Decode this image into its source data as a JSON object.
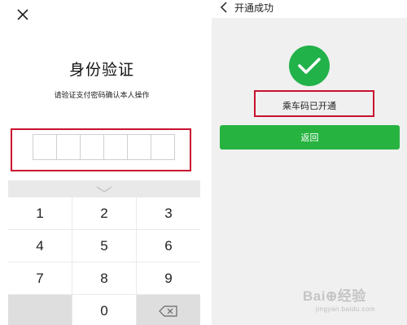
{
  "left": {
    "title": "身份验证",
    "subtitle": "请验证支付密码确认本人操作",
    "icons": {
      "close": "close-icon",
      "handle": "chevron-down-icon",
      "backspace": "backspace-icon"
    },
    "keypad": {
      "keys": [
        {
          "label": "1"
        },
        {
          "label": "2"
        },
        {
          "label": "3"
        },
        {
          "label": "4"
        },
        {
          "label": "5"
        },
        {
          "label": "6"
        },
        {
          "label": "7"
        },
        {
          "label": "8"
        },
        {
          "label": "9"
        },
        {
          "label": ""
        },
        {
          "label": "0"
        },
        {
          "label": ""
        }
      ]
    },
    "colors": {
      "highlight": "#c8102e"
    }
  },
  "right": {
    "header": {
      "title": "开通成功"
    },
    "icons": {
      "back": "chevron-left-icon",
      "success": "check-circle-icon"
    },
    "status": {
      "text": "乘车码已开通"
    },
    "return_button": {
      "label": "返回"
    },
    "colors": {
      "success": "#21b24a",
      "button": "#26b340",
      "highlight": "#c8102e"
    }
  },
  "watermark": {
    "brand": "Bai⊕经验",
    "site": "jingyan.baidu.com"
  }
}
